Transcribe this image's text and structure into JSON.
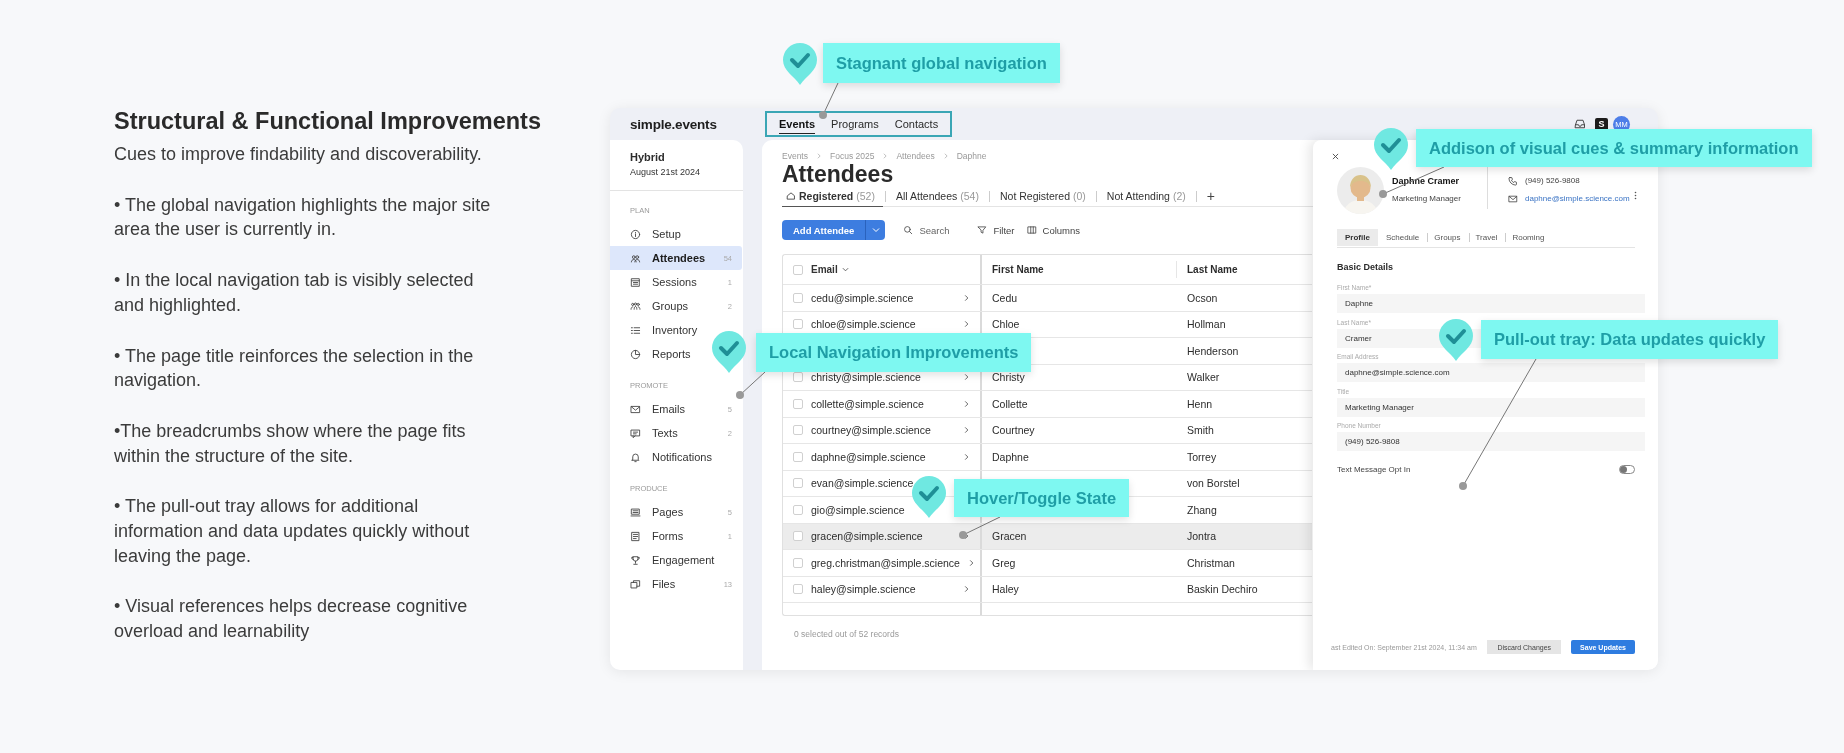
{
  "intro": {
    "title": "Structural & Functional Improvements",
    "subtitle": "Cues to improve findability and discoverability.",
    "points": [
      "• The global navigation highlights the major site area the user is currently in.",
      "• In the local navigation tab is visibly selected and highlighted.",
      "• The page title reinforces the selection in the navigation.",
      "•The breadcrumbs show where the page fits within the structure of the site.",
      "• The pull-out tray allows for additional information and data updates quickly without leaving the page.",
      "• Visual references helps decrease cognitive overload and learnability"
    ]
  },
  "app": {
    "logo": "simple.events",
    "global_nav": [
      {
        "label": "Events",
        "selected": true
      },
      {
        "label": "Programs",
        "selected": false
      },
      {
        "label": "Contacts",
        "selected": false
      }
    ],
    "org_badge": "S",
    "user_initials": "MM"
  },
  "sidebar": {
    "event_name": "Hybrid",
    "event_date": "August 21st 2024",
    "sections": [
      {
        "heading": "PLAN",
        "items": [
          {
            "label": "Setup",
            "selected": false
          },
          {
            "label": "Attendees",
            "count": "54",
            "selected": true
          },
          {
            "label": "Sessions",
            "count": "1",
            "selected": false
          },
          {
            "label": "Groups",
            "count": "2",
            "selected": false
          },
          {
            "label": "Inventory",
            "selected": false
          },
          {
            "label": "Reports",
            "selected": false
          }
        ]
      },
      {
        "heading": "PROMOTE",
        "items": [
          {
            "label": "Emails",
            "count": "5",
            "selected": false
          },
          {
            "label": "Texts",
            "count": "2",
            "selected": false
          },
          {
            "label": "Notifications",
            "selected": false
          }
        ]
      },
      {
        "heading": "PRODUCE",
        "items": [
          {
            "label": "Pages",
            "count": "5",
            "selected": false
          },
          {
            "label": "Forms",
            "count": "1",
            "selected": false
          },
          {
            "label": "Engagement",
            "selected": false
          },
          {
            "label": "Files",
            "count": "13",
            "selected": false
          }
        ]
      }
    ]
  },
  "page": {
    "breadcrumbs": [
      "Events",
      "Focus 2025",
      "Attendees",
      "Daphne"
    ],
    "title": "Attendees",
    "tabs": [
      {
        "label": "Registered",
        "count": "(52)",
        "selected": true
      },
      {
        "label": "All Attendees",
        "count": "(54)",
        "selected": false
      },
      {
        "label": "Not Registered",
        "count": "(0)",
        "selected": false
      },
      {
        "label": "Not Attending",
        "count": "(2)",
        "selected": false
      }
    ],
    "add_tab": "+",
    "toolbar": {
      "add_button": "Add Attendee",
      "search_placeholder": "Search",
      "filter": "Filter",
      "columns": "Columns"
    },
    "table": {
      "select_all_checked": false,
      "columns": [
        "Email",
        "First Name",
        "Last Name"
      ],
      "rows": [
        {
          "email": "cedu@simple.science",
          "first_name": "Cedu",
          "last_name": "Ocson",
          "checked": false,
          "hovered": false
        },
        {
          "email": "chloe@simple.science",
          "first_name": "Chloe",
          "last_name": "Hollman",
          "checked": false,
          "hovered": false
        },
        {
          "last_name": "Henderson",
          "hovered": false
        },
        {
          "email": "christy@simple.science",
          "first_name": "Christy",
          "last_name": "Walker",
          "checked": false,
          "hovered": false
        },
        {
          "email": "collette@simple.science",
          "first_name": "Collette",
          "last_name": "Henn",
          "checked": false,
          "hovered": false
        },
        {
          "email": "courtney@simple.science",
          "first_name": "Courtney",
          "last_name": "Smith",
          "checked": false,
          "hovered": false
        },
        {
          "email": "daphne@simple.science",
          "first_name": "Daphne",
          "last_name": "Torrey",
          "checked": false,
          "hovered": false
        },
        {
          "email": "evan@simple.science",
          "last_name": "von Borstel",
          "checked": false,
          "hovered": false
        },
        {
          "email": "gio@simple.science",
          "last_name": "Zhang",
          "checked": false,
          "hovered": false
        },
        {
          "email": "gracen@simple.science",
          "first_name": "Gracen",
          "last_name": "Jontra",
          "checked": false,
          "hovered": true
        },
        {
          "email": "greg.christman@simple.science",
          "first_name": "Greg",
          "last_name": "Christman",
          "checked": false,
          "hovered": false
        },
        {
          "email": "haley@simple.science",
          "first_name": "Haley",
          "last_name": "Baskin Dechiro",
          "checked": false,
          "hovered": false
        }
      ],
      "footer": "0 selected out of 52 records"
    }
  },
  "tray": {
    "name": "Daphne Cramer",
    "role": "Marketing Manager",
    "phone": "(949) 526-9808",
    "email": "daphne@simple.science.com",
    "tabs": [
      {
        "label": "Profile",
        "selected": true
      },
      {
        "label": "Schedule",
        "selected": false
      },
      {
        "label": "Groups",
        "selected": false
      },
      {
        "label": "Travel",
        "selected": false
      },
      {
        "label": "Rooming",
        "selected": false
      }
    ],
    "section_title": "Basic Details",
    "fields": [
      {
        "label": "First Name*",
        "value": "Daphne"
      },
      {
        "label": "Last Name*",
        "value": "Cramer"
      },
      {
        "label": "Email Address",
        "value": "daphne@simple.science.com"
      },
      {
        "label": "Title",
        "value": "Marketing Manager"
      },
      {
        "label": "Phone Number",
        "value": "(949) 526-9808"
      }
    ],
    "opt_in": {
      "label": "Text Message Opt In",
      "on": false
    },
    "last_edited": "ast Edited On: September 21st 2024, 11:34 am",
    "buttons": [
      "Discard Changes",
      "Save Updates"
    ]
  },
  "callouts": [
    {
      "text": "Stagnant global navigation"
    },
    {
      "text": "Addison of visual cues & summary information"
    },
    {
      "text": "Local Navigation Improvements"
    },
    {
      "text": "Hover/Toggle State"
    },
    {
      "text": "Pull-out tray: Data updates quickly"
    }
  ]
}
